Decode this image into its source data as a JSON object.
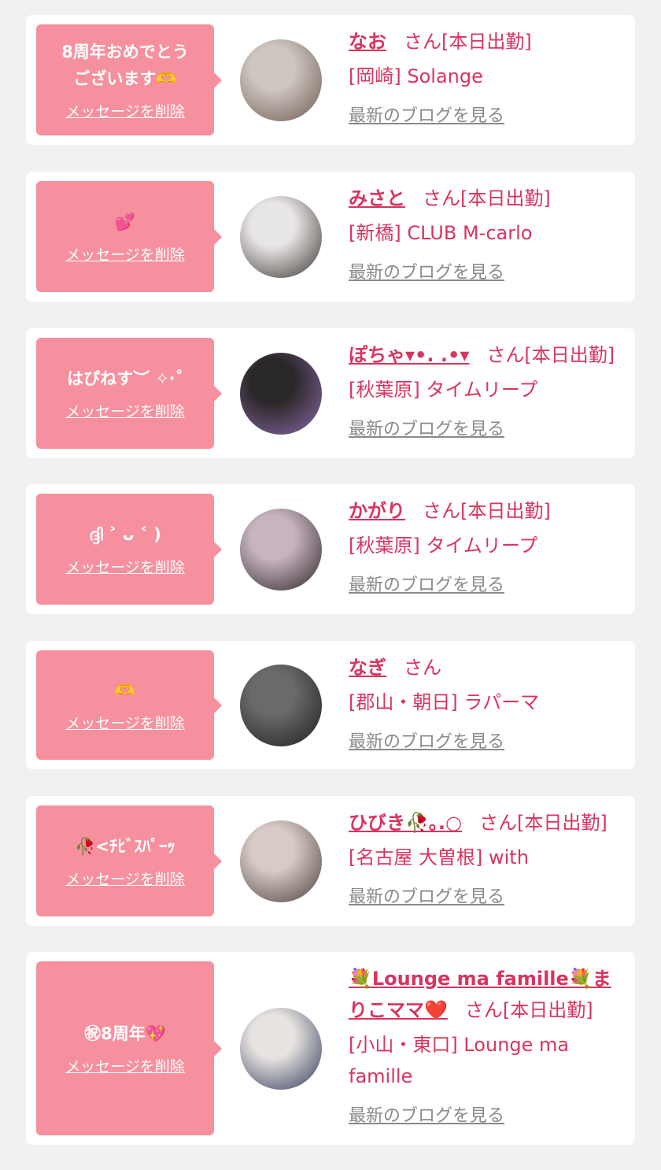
{
  "delete_label": "メッセージを削除",
  "blog_label": "最新のブログを見る",
  "colors": {
    "background": "#f2f1f1",
    "card": "#ffffff",
    "bubble": "#f6909e",
    "accent": "#d9345f",
    "link_gray": "#8a8a8a"
  },
  "entries": [
    {
      "message": "8周年おめでとう\nございます🫶",
      "name": "なお",
      "honorific": "さん",
      "status": "[本日出勤]",
      "shop": "[岡崎] Solange",
      "avatar_colors": [
        "#cfc6c0",
        "#6b5a52"
      ]
    },
    {
      "message": "💕",
      "name": "みさと",
      "honorific": "さん",
      "status": "[本日出勤]",
      "shop": "[新橋] CLUB M-carlo",
      "avatar_colors": [
        "#e9e7e6",
        "#3b3432"
      ]
    },
    {
      "message": "はぴねす︶ ✧‧˚",
      "name": "ぽちゃ▾•. .•▾",
      "honorific": "さん",
      "status": "[本日出勤]",
      "shop": "[秋葉原] タイムリープ",
      "avatar_colors": [
        "#2a2728",
        "#8d6aa8"
      ]
    },
    {
      "message": "ദ്ദി ˃ ᴗ ˂ )",
      "name": "かがり",
      "honorific": "さん",
      "status": "[本日出勤]",
      "shop": "[秋葉原] タイムリープ",
      "avatar_colors": [
        "#c8b4c0",
        "#2d2427"
      ]
    },
    {
      "message": "🫶",
      "name": "なぎ",
      "honorific": "さん",
      "status": "",
      "shop": "[郡山・朝日] ラパーマ",
      "avatar_colors": [
        "#6b6a68",
        "#1f1d1e"
      ]
    },
    {
      "message": "🥀<ﾁﾋﾞｽﾊﾟｰｯ",
      "name": "ひびき🥀｡.○",
      "honorific": "さん",
      "status": "[本日出勤]",
      "shop": "[名古屋 大曽根] with",
      "avatar_colors": [
        "#d8cbc7",
        "#4b3f3c"
      ]
    },
    {
      "message": "㊗8周年💖",
      "name": "💐Lounge ma famille💐まりこママ❤️",
      "honorific": "さん",
      "status": "[本日出勤]",
      "shop": "[小山・東口] Lounge ma famille",
      "avatar_colors": [
        "#e7e3e0",
        "#2f3a58"
      ]
    }
  ]
}
